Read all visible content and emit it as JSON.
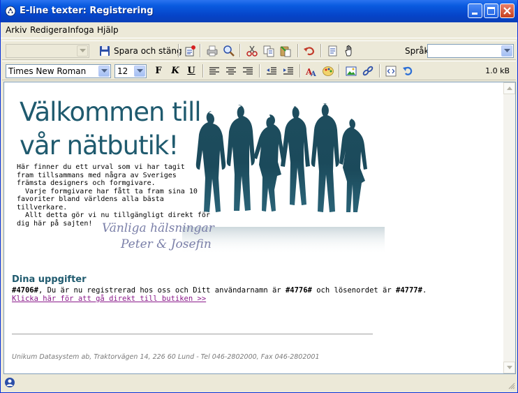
{
  "window": {
    "title": "E-line texter: Registrering"
  },
  "menu": {
    "items": [
      "Arkiv",
      "Redigera",
      "Infoga",
      "Hjälp"
    ]
  },
  "toolbar1": {
    "style_select": {
      "value": "",
      "disabled": true
    },
    "save_label": "Spara och stäng",
    "language_label": "Språk",
    "language_select": {
      "value": ""
    },
    "icons": [
      "save-icon",
      "properties-icon",
      "print-icon",
      "preview-icon",
      "cut-icon",
      "copy-icon",
      "paste-icon",
      "undo-icon",
      "page-icon",
      "hand-icon"
    ]
  },
  "toolbar2": {
    "font_family": "Times New Roman",
    "font_size": "12",
    "bold_label": "F",
    "italic_label": "K",
    "underline_label": "U",
    "size_indicator": "1.0 kB"
  },
  "document": {
    "welcome_line1": "Välkommen till",
    "welcome_line2": "vår nätbutik!",
    "intro_lines": [
      "Här finner du ett urval som vi har tagit",
      "fram tillsammans med några av Sveriges",
      "främsta designers och formgivare.",
      "  Varje formgivare har fått ta fram sina 10",
      "favoriter bland världens alla bästa",
      "tillverkare.",
      "  Allt detta gör vi nu tillgängligt direkt för",
      "dig här på sajten!"
    ],
    "signature_line1": "Vänliga hälsningar",
    "signature_line2": "Peter & Josefin",
    "heading": "Dina uppgifter",
    "reg_part1": "#4706#",
    "reg_part2": ", Du är nu registrerad hos oss och Ditt användarnamn är ",
    "reg_part3": "#4776#",
    "reg_part4": " och lösenordet är ",
    "reg_part5": "#4777#",
    "reg_part6": ".",
    "link_text": "Klicka här för att gå direkt till butiken >>",
    "footer": "Unikum Datasystem ab, Traktorvägen 14, 226 60 Lund - Tel 046-2802000, Fax 046-2802001"
  },
  "colors": {
    "heading": "#1f5a6e",
    "link": "#8a1a8a",
    "titlebar": "#0a5be0"
  }
}
